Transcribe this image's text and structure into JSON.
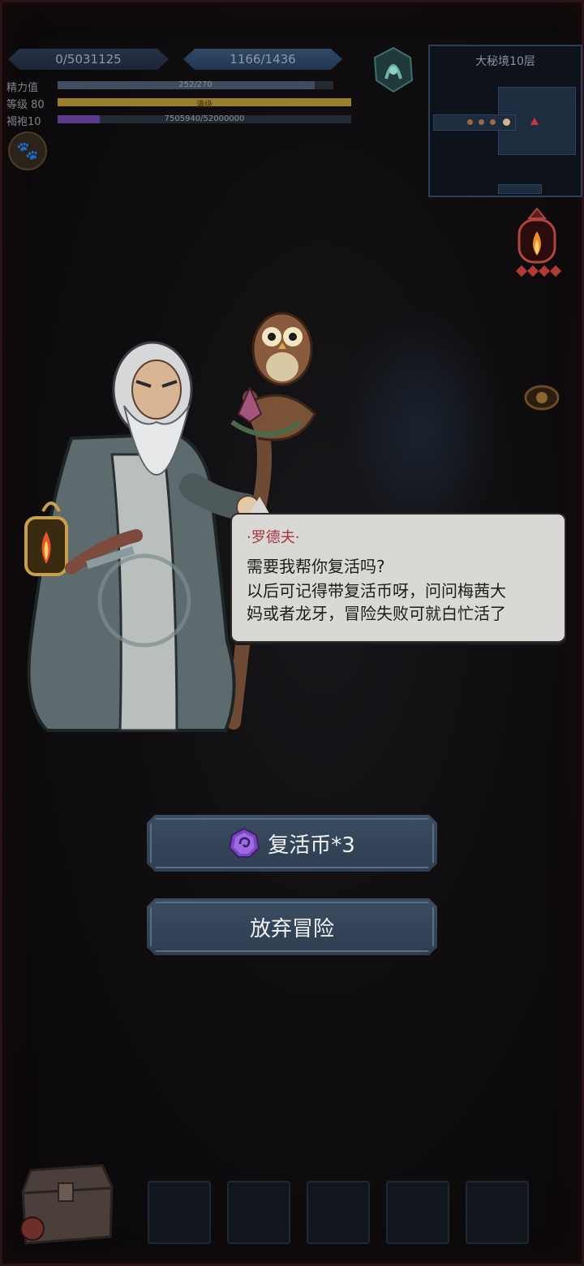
{
  "hud": {
    "gold": "0/5031125",
    "hp": "1166/1436",
    "stats": [
      {
        "label": "精力值",
        "text": "252/270",
        "fraction": 0.933,
        "color": "#3e4d5f"
      },
      {
        "label": "等级 80",
        "text": "满级",
        "fraction": 1.0,
        "color": "#9a7f2a"
      },
      {
        "label": "褐袍10",
        "text": "7505940/52000000",
        "fraction": 0.144,
        "color": "#5a3c8a"
      }
    ],
    "paw_icon": "paw-icon"
  },
  "minimap": {
    "title": "大秘境10层"
  },
  "dialog": {
    "speaker": "·罗德夫·",
    "lines": [
      "需要我帮你复活吗?",
      "以后可记得带复活币呀，问问梅茜大",
      "妈或者龙牙，冒险失败可就白忙活了"
    ]
  },
  "buttons": {
    "revive": "复活币*3",
    "abandon": "放弃冒险"
  },
  "colors": {
    "button_bg": "#34455a",
    "dialog_bg": "#d9d8d4",
    "speaker": "#a3333c"
  }
}
